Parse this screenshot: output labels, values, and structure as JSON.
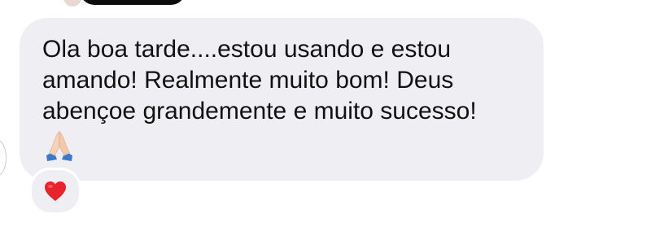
{
  "message": {
    "text": "Ola boa tarde....estou usando e estou\namando! Realmente muito bom! Deus\nabençoe grandemente e muito sucesso!",
    "emoji": "praying-hands-icon"
  },
  "reaction": {
    "emoji": "heart-icon",
    "color": "#e8232b"
  },
  "colors": {
    "bubble_background": "#efeff3",
    "text": "#111111"
  }
}
